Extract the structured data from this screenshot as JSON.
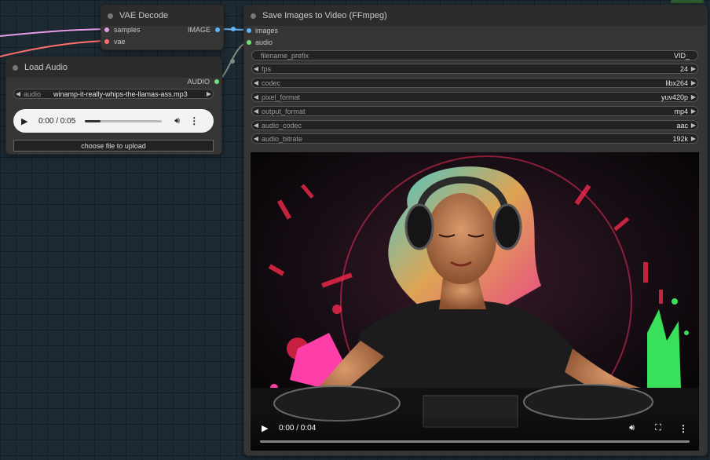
{
  "vae_decode": {
    "title": "VAE Decode",
    "inputs": [
      {
        "label": "samples",
        "color": "#e59be6"
      },
      {
        "label": "vae",
        "color": "#ff6e6e"
      }
    ],
    "output": {
      "label": "IMAGE",
      "color": "#64b5f6"
    }
  },
  "load_audio": {
    "title": "Load Audio",
    "output": {
      "label": "AUDIO",
      "color": "#76e07a"
    },
    "audio_widget": {
      "name": "audio",
      "value": "winamp-it-really-whips-the-llamas-ass.mp3"
    },
    "player": {
      "time": "0:00 / 0:05",
      "progress": 0.2
    },
    "upload_label": "choose file to upload"
  },
  "save_video": {
    "title": "Save Images to Video (FFmpeg)",
    "inputs": [
      {
        "label": "images",
        "color": "#64b5f6"
      },
      {
        "label": "audio",
        "color": "#76e07a"
      }
    ],
    "filename_prefix": {
      "name": "filename_prefix",
      "value": "VID_"
    },
    "widgets": [
      {
        "name": "fps",
        "value": "24"
      },
      {
        "name": "codec",
        "value": "libx264"
      },
      {
        "name": "pixel_format",
        "value": "yuv420p"
      },
      {
        "name": "output_format",
        "value": "mp4"
      },
      {
        "name": "audio_codec",
        "value": "aac"
      },
      {
        "name": "audio_bitrate",
        "value": "192k"
      }
    ],
    "video": {
      "time": "0:00 / 0:04",
      "progress": 0.0
    }
  },
  "colors": {
    "link_pink": "#e59be6",
    "link_red": "#ff6e6e",
    "link_blue": "#64b5f6",
    "link_gray": "#7f8c80"
  }
}
